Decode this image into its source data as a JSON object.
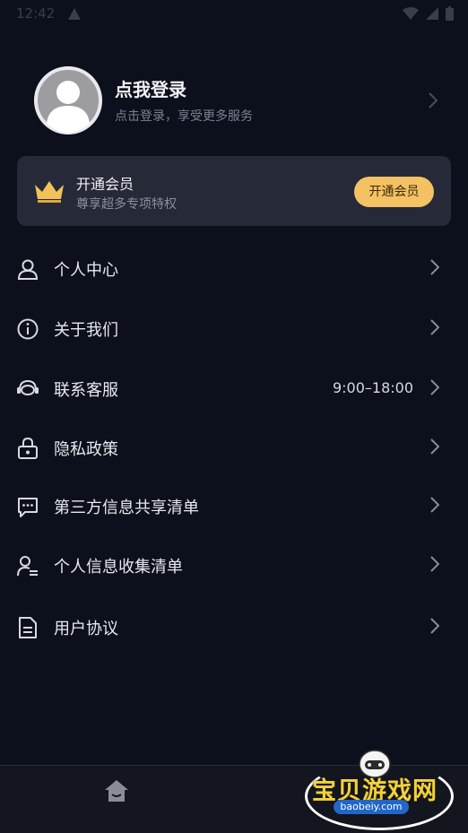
{
  "status": {
    "time": "12:42"
  },
  "profile": {
    "title": "点我登录",
    "subtitle": "点击登录，享受更多服务"
  },
  "vip": {
    "title": "开通会员",
    "subtitle": "尊享超多专项特权",
    "button": "开通会员",
    "accent": "#f4c163"
  },
  "menu": [
    {
      "label": "个人中心",
      "icon": "person-icon"
    },
    {
      "label": "关于我们",
      "icon": "info-icon"
    },
    {
      "label": "联系客服",
      "icon": "headset-icon",
      "value": "9:00–18:00"
    },
    {
      "label": "隐私政策",
      "icon": "lock-icon"
    },
    {
      "label": "第三方信息共享清单",
      "icon": "message-icon"
    },
    {
      "label": "个人信息收集清单",
      "icon": "user-list-icon"
    },
    {
      "label": "用户协议",
      "icon": "document-icon"
    }
  ],
  "watermark": {
    "text": "宝贝游戏网",
    "url": "baobeiy.com"
  }
}
